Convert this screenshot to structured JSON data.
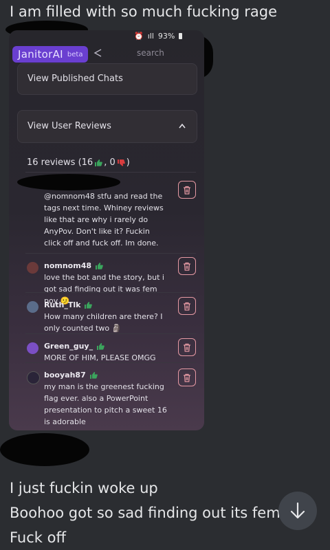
{
  "messages": [
    "I am filled with so much fucking rage",
    "I just fuckin woke up",
    "Boohoo got so sad finding out its fempov",
    "Fuck off"
  ],
  "screenshot": {
    "status_battery": "93%",
    "app_name": "JanitorAI",
    "beta_badge": "beta",
    "search_placeholder": "search",
    "published_chats_label": "View Published Chats",
    "user_reviews_label": "View User Reviews",
    "reviews_count_prefix": "16 reviews (16",
    "reviews_count_mid": ", 0",
    "reviews_count_suffix": ")",
    "reviews": [
      {
        "user": "",
        "avatar_color": "#222222",
        "text": "@nomnom48 stfu and read the tags next time. Whiney reviews like that are why i rarely do AnyPov. Don't like it? Fuckin click off and fuck off. Im done."
      },
      {
        "user": "nomnom48",
        "avatar_color": "#6b3a3a",
        "text": "love the bot and the story, but i got sad finding out it was fem pov 🫤"
      },
      {
        "user": "Ruth_Tlk",
        "avatar_color": "#5a6c8a",
        "text": "How many children are there? I only counted two 🗿"
      },
      {
        "user": "Green_guy_",
        "avatar_color": "#7b4fc4",
        "text": "MORE OF HIM, PLEASE OMGG"
      },
      {
        "user": "booyah87",
        "avatar_color": "#2a2438",
        "text": "my man is the greenest fucking flag ever. also a PowerPoint presentation to pitch a sweet 16 is adorable"
      }
    ]
  },
  "colors": {
    "discord_bg": "#2b2d31",
    "accent_purple": "#6a3fd0",
    "thumb_up": "#3ba55d",
    "thumb_down": "#d83c3e",
    "delete_border": "#e79aa4"
  },
  "icons": {
    "scroll_down": "arrow-down-icon"
  }
}
